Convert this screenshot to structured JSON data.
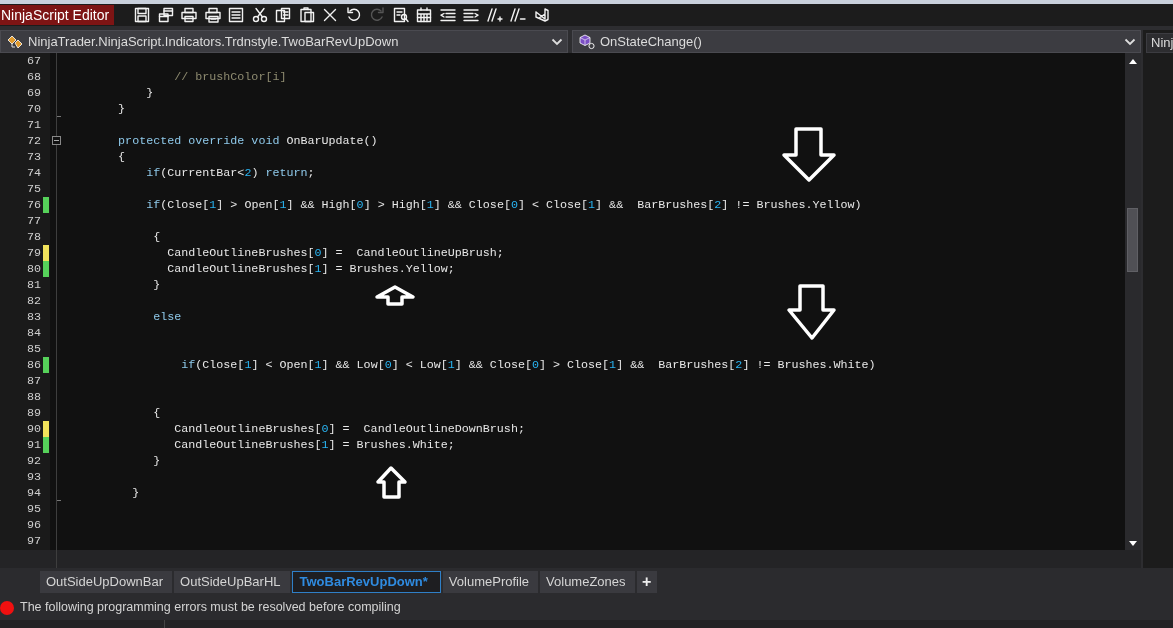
{
  "window": {
    "title": "NinjaScript Editor"
  },
  "toolbar": [
    {
      "disabled": false
    },
    {
      "disabled": false
    },
    {
      "disabled": false
    },
    {
      "disabled": false
    },
    {
      "disabled": false
    },
    {
      "disabled": false
    },
    {
      "disabled": false
    },
    {
      "disabled": false
    },
    {
      "disabled": false
    },
    {
      "disabled": false
    },
    {
      "disabled": true
    },
    {
      "disabled": false
    },
    {
      "disabled": false
    },
    {
      "disabled": false
    },
    {
      "disabled": false
    },
    {
      "disabled": false
    },
    {
      "disabled": false
    },
    {
      "disabled": false
    }
  ],
  "type_selector": {
    "value": "NinjaTrader.NinjaScript.Indicators.Trdnstyle.TwoBarRevUpDown"
  },
  "member_selector": {
    "value": "OnStateChange()"
  },
  "side_panel": {
    "tab": "Ninj"
  },
  "lines": [
    {
      "number": "67"
    },
    {
      "number": "68",
      "tokens": [
        {
          "kind": "comment",
          "text": "                // brushColor[i]"
        }
      ]
    },
    {
      "number": "69",
      "tokens": [
        {
          "kind": "plain",
          "text": "            }"
        }
      ]
    },
    {
      "number": "70",
      "fold_end": true,
      "tokens": [
        {
          "kind": "plain",
          "text": "        }"
        }
      ]
    },
    {
      "number": "71"
    },
    {
      "number": "72",
      "expanded": true,
      "tokens": [
        {
          "kind": "keyword",
          "text": "        protected override void"
        },
        {
          "kind": "plain",
          "text": " OnBarUpdate()"
        }
      ]
    },
    {
      "number": "73",
      "tokens": [
        {
          "kind": "plain",
          "text": "        {"
        }
      ]
    },
    {
      "number": "74",
      "tokens": [
        {
          "kind": "keyword",
          "text": "            if"
        },
        {
          "kind": "plain",
          "text": "(CurrentBar<"
        },
        {
          "kind": "number",
          "text": "2"
        },
        {
          "kind": "plain",
          "text": ") "
        },
        {
          "kind": "keyword",
          "text": "return"
        },
        {
          "kind": "plain",
          "text": ";"
        }
      ]
    },
    {
      "number": "75"
    },
    {
      "number": "76",
      "changed": true,
      "saved": true,
      "tokens": [
        {
          "kind": "keyword",
          "text": "            if"
        },
        {
          "kind": "plain",
          "text": "(Close["
        },
        {
          "kind": "number",
          "text": "1"
        },
        {
          "kind": "plain",
          "text": "] > Open["
        },
        {
          "kind": "number",
          "text": "1"
        },
        {
          "kind": "plain",
          "text": "] && High["
        },
        {
          "kind": "number",
          "text": "0"
        },
        {
          "kind": "plain",
          "text": "] > High["
        },
        {
          "kind": "number",
          "text": "1"
        },
        {
          "kind": "plain",
          "text": "] && Close["
        },
        {
          "kind": "number",
          "text": "0"
        },
        {
          "kind": "plain",
          "text": "] < Close["
        },
        {
          "kind": "number",
          "text": "1"
        },
        {
          "kind": "plain",
          "text": "] &&  BarBrushes["
        },
        {
          "kind": "number",
          "text": "2"
        },
        {
          "kind": "plain",
          "text": "] != Brushes.Yellow)"
        }
      ]
    },
    {
      "number": "77"
    },
    {
      "number": "78",
      "tokens": [
        {
          "kind": "plain",
          "text": "             {"
        }
      ]
    },
    {
      "number": "79",
      "changed": true,
      "saved": false,
      "tokens": [
        {
          "kind": "plain",
          "text": "               CandleOutlineBrushes["
        },
        {
          "kind": "number",
          "text": "0"
        },
        {
          "kind": "plain",
          "text": "] =  CandleOutlineUpBrush;"
        }
      ]
    },
    {
      "number": "80",
      "changed": true,
      "saved": true,
      "tokens": [
        {
          "kind": "plain",
          "text": "               CandleOutlineBrushes["
        },
        {
          "kind": "number",
          "text": "1"
        },
        {
          "kind": "plain",
          "text": "] = Brushes.Yellow;"
        }
      ]
    },
    {
      "number": "81",
      "tokens": [
        {
          "kind": "plain",
          "text": "             }"
        }
      ]
    },
    {
      "number": "82"
    },
    {
      "number": "83",
      "tokens": [
        {
          "kind": "keyword",
          "text": "             else"
        }
      ]
    },
    {
      "number": "84"
    },
    {
      "number": "85"
    },
    {
      "number": "86",
      "changed": true,
      "saved": true,
      "tokens": [
        {
          "kind": "keyword",
          "text": "                 if"
        },
        {
          "kind": "plain",
          "text": "(Close["
        },
        {
          "kind": "number",
          "text": "1"
        },
        {
          "kind": "plain",
          "text": "] < Open["
        },
        {
          "kind": "number",
          "text": "1"
        },
        {
          "kind": "plain",
          "text": "] && Low["
        },
        {
          "kind": "number",
          "text": "0"
        },
        {
          "kind": "plain",
          "text": "] < Low["
        },
        {
          "kind": "number",
          "text": "1"
        },
        {
          "kind": "plain",
          "text": "] && Close["
        },
        {
          "kind": "number",
          "text": "0"
        },
        {
          "kind": "plain",
          "text": "] > Close["
        },
        {
          "kind": "number",
          "text": "1"
        },
        {
          "kind": "plain",
          "text": "] &&  BarBrushes["
        },
        {
          "kind": "number",
          "text": "2"
        },
        {
          "kind": "plain",
          "text": "] != Brushes.White)"
        }
      ]
    },
    {
      "number": "87"
    },
    {
      "number": "88"
    },
    {
      "number": "89",
      "tokens": [
        {
          "kind": "plain",
          "text": "             {"
        }
      ]
    },
    {
      "number": "90",
      "changed": true,
      "saved": false,
      "tokens": [
        {
          "kind": "plain",
          "text": "                CandleOutlineBrushes["
        },
        {
          "kind": "number",
          "text": "0"
        },
        {
          "kind": "plain",
          "text": "] =  CandleOutlineDownBrush;"
        }
      ]
    },
    {
      "number": "91",
      "changed": true,
      "saved": true,
      "tokens": [
        {
          "kind": "plain",
          "text": "                CandleOutlineBrushes["
        },
        {
          "kind": "number",
          "text": "1"
        },
        {
          "kind": "plain",
          "text": "] = Brushes.White;"
        }
      ]
    },
    {
      "number": "92",
      "tokens": [
        {
          "kind": "plain",
          "text": "             }"
        }
      ]
    },
    {
      "number": "93"
    },
    {
      "number": "94",
      "fold_end": true,
      "tokens": [
        {
          "kind": "plain",
          "text": "          }"
        }
      ]
    },
    {
      "number": "95"
    },
    {
      "number": "96"
    },
    {
      "number": "97"
    }
  ],
  "tabs": [
    {
      "label": "OutSideUpDownBar",
      "selected": false
    },
    {
      "label": "OutSideUpBarHL",
      "selected": false
    },
    {
      "label": "TwoBarRevUpDown*",
      "selected": true
    },
    {
      "label": "VolumeProfile",
      "selected": false
    },
    {
      "label": "VolumeZones",
      "selected": false
    }
  ],
  "add_tab": "+",
  "status": {
    "error": true,
    "text": "The following programming errors must be resolved before compiling"
  }
}
